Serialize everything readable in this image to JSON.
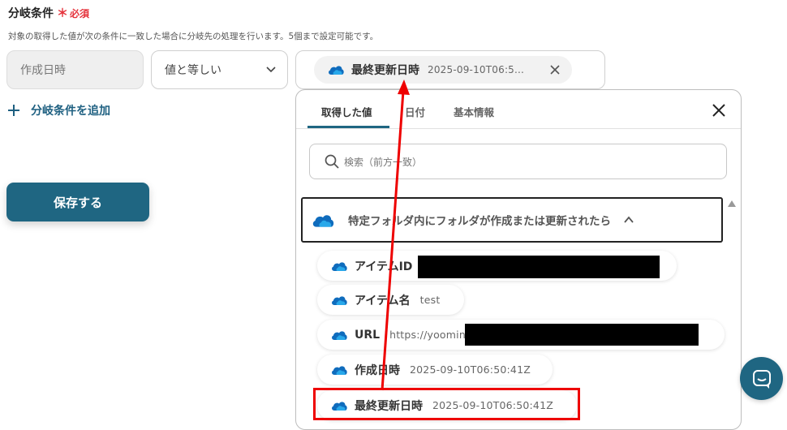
{
  "section": {
    "title": "分岐条件",
    "required_mark": "＊",
    "required_text": "必須",
    "description": "対象の取得した値が次の条件に一致した場合に分岐先の処理を行います。5個まで設定可能です。"
  },
  "condition": {
    "left_value": "作成日時",
    "operator": "値と等しい",
    "chip_name": "最終更新日時",
    "chip_value": "2025-09-10T06:5..."
  },
  "add_condition_label": "分岐条件を追加",
  "save_label": "保存する",
  "panel": {
    "tabs": [
      "取得した値",
      "日付",
      "基本情報"
    ],
    "active_tab": "取得した値",
    "search_placeholder": "検索（前方一致）",
    "group_label": "特定フォルダ内にフォルダが作成または更新されたら",
    "items": [
      {
        "name": "アイテムID",
        "value": ""
      },
      {
        "name": "アイテム名",
        "value": "test"
      },
      {
        "name": "URL",
        "value": "https://yoominc"
      },
      {
        "name": "作成日時",
        "value": "2025-09-10T06:50:41Z"
      },
      {
        "name": "最終更新日時",
        "value": "2025-09-10T06:50:41Z"
      }
    ]
  },
  "colors": {
    "accent": "#1f6682",
    "required": "#e5323b",
    "highlight": "#e00000",
    "cloud": "#0f6cbd"
  },
  "icons": [
    "onedrive-cloud-icon",
    "chevron-down-icon",
    "close-icon",
    "plus-icon",
    "search-icon",
    "chevron-up-icon",
    "chat-icon"
  ]
}
